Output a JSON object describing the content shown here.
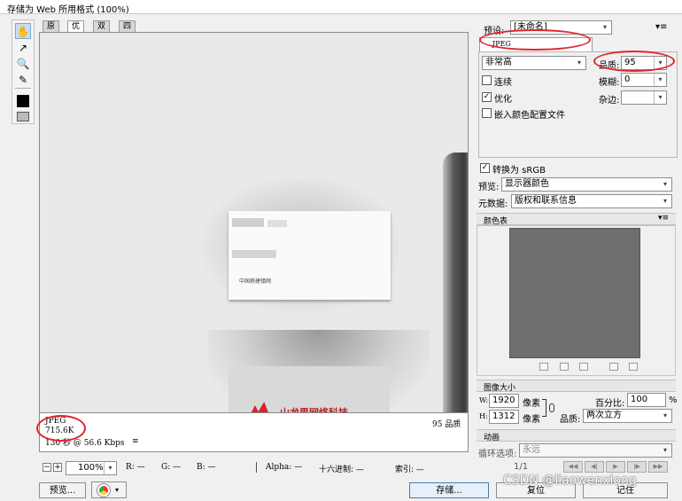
{
  "window": {
    "title": "存储为 Web 所用格式 (100%)"
  },
  "view_tabs": [
    "原稿",
    "优化",
    "双联",
    "四联"
  ],
  "preview": {
    "company_text": "中国移建镇网",
    "bottom_company_text": "山龙思网络科技"
  },
  "info": {
    "format": "JPEG",
    "size": "715.6K",
    "time": "130 秒 @ 56.6 Kbps",
    "menu_glyph": "≡",
    "quality_text": "95 品质"
  },
  "status_bar": {
    "zoom": "100%",
    "r": "R: —",
    "g": "G: —",
    "b": "B: —",
    "alpha": "Alpha: —",
    "hex": "十六进制: —",
    "index": "索引: —"
  },
  "buttons": {
    "preview": "预览...",
    "save": "存储...",
    "reset": "复位",
    "remember": "记住"
  },
  "settings": {
    "preset_label": "预设:",
    "preset_value": "[未命名]",
    "format_value": "JPEG",
    "compression": "非常高",
    "quality_label": "品质:",
    "quality_value": "95",
    "blur_label": "模糊:",
    "blur_value": "0",
    "matte_label": "杂边:",
    "matte_value": "",
    "progressive_label": "连续",
    "progressive_checked": false,
    "optimized_label": "优化",
    "optimized_checked": true,
    "embed_label": "嵌入颜色配置文件",
    "embed_checked": false,
    "convert_srgb_label": "转换为 sRGB",
    "convert_srgb_checked": true,
    "preview_label": "预览:",
    "preview_value": "显示器颜色",
    "metadata_label": "元数据:",
    "metadata_value": "版权和联系信息"
  },
  "color_table": {
    "title": "颜色表",
    "swatch_color": "#6e6e6e"
  },
  "image_size": {
    "title": "图像大小",
    "w_label": "W:",
    "w_value": "1920",
    "h_label": "H:",
    "h_value": "1312",
    "unit": "像素",
    "percent_label": "百分比:",
    "percent_value": "100",
    "percent_unit": "%",
    "quality_label": "品质:",
    "quality_value": "两次立方"
  },
  "animation": {
    "title": "动画",
    "loop_label": "循环选项:",
    "loop_value": "永远",
    "frame": "1/1"
  },
  "watermark": "CSDN @liaowenxiong",
  "colors": {
    "annotation_red": "#e0262b",
    "accent_blue": "#3c7fb1"
  }
}
